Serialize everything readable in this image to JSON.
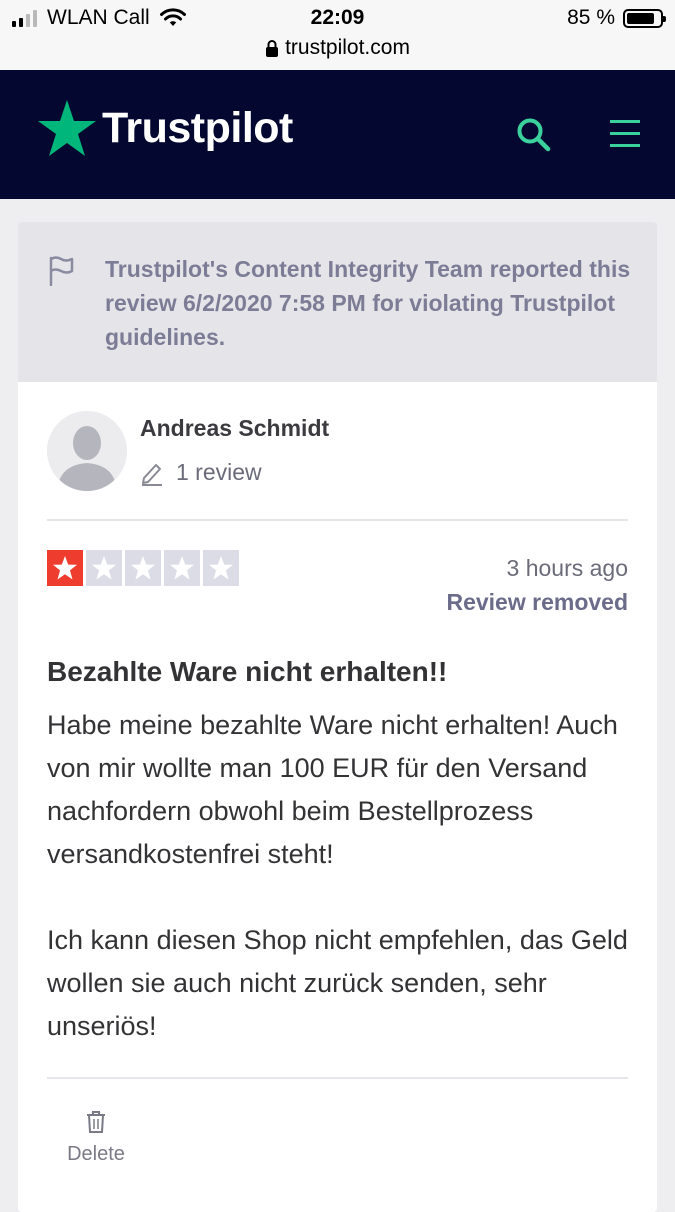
{
  "status_bar": {
    "carrier": "WLAN Call",
    "time": "22:09",
    "battery": "85 %",
    "battery_level": 0.85,
    "url": "trustpilot.com"
  },
  "header": {
    "logo": "Trustpilot",
    "icons": [
      "search-icon",
      "menu-icon"
    ],
    "brand_color": "#00b67a",
    "bg_color": "#040830"
  },
  "notice": {
    "icon": "flag-icon",
    "text": "Trustpilot's Content Integrity Team reported this review 6/2/2020 7:58 PM for violating Trustpilot guidelines."
  },
  "reviewer": {
    "name": "Andreas Schmidt",
    "review_count": "1 review"
  },
  "review": {
    "rating": 1,
    "rating_max": 5,
    "star_color": "#ee3c2e",
    "time_ago": "3 hours ago",
    "status": "Review removed",
    "title": "Bezahlte Ware nicht erhalten!!",
    "body": "Habe meine bezahlte Ware nicht erhalten! Auch von mir wollte man 100 EUR für den Versand nachfordern obwohl beim Bestellprozess versandkostenfrei steht!\n\nIch kann diesen Shop nicht empfehlen, das Geld wollen sie auch nicht zurück senden, sehr unseriös!"
  },
  "actions": {
    "delete_label": "Delete"
  }
}
